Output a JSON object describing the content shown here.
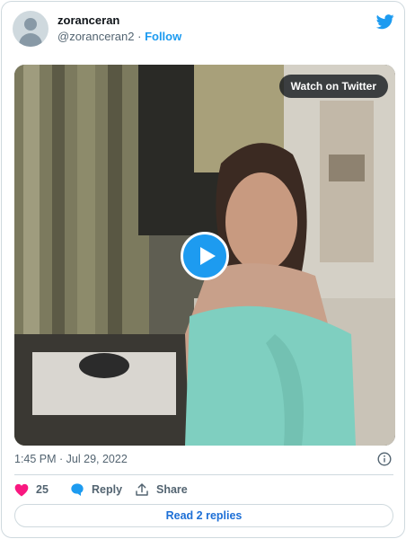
{
  "author": {
    "display_name": "zoranceran",
    "handle": "@zoranceran2",
    "separator": "·",
    "follow_label": "Follow"
  },
  "media": {
    "watch_label": "Watch on Twitter",
    "play_icon": "play-icon"
  },
  "meta": {
    "timestamp": "1:45 PM · Jul 29, 2022",
    "info_icon": "info-icon"
  },
  "actions": {
    "like_count": "25",
    "reply_label": "Reply",
    "share_label": "Share"
  },
  "replies": {
    "label": "Read 2 replies"
  },
  "colors": {
    "accent": "#1d9bf0",
    "like": "#f91880",
    "muted": "#536471",
    "border": "#cfd9de"
  }
}
